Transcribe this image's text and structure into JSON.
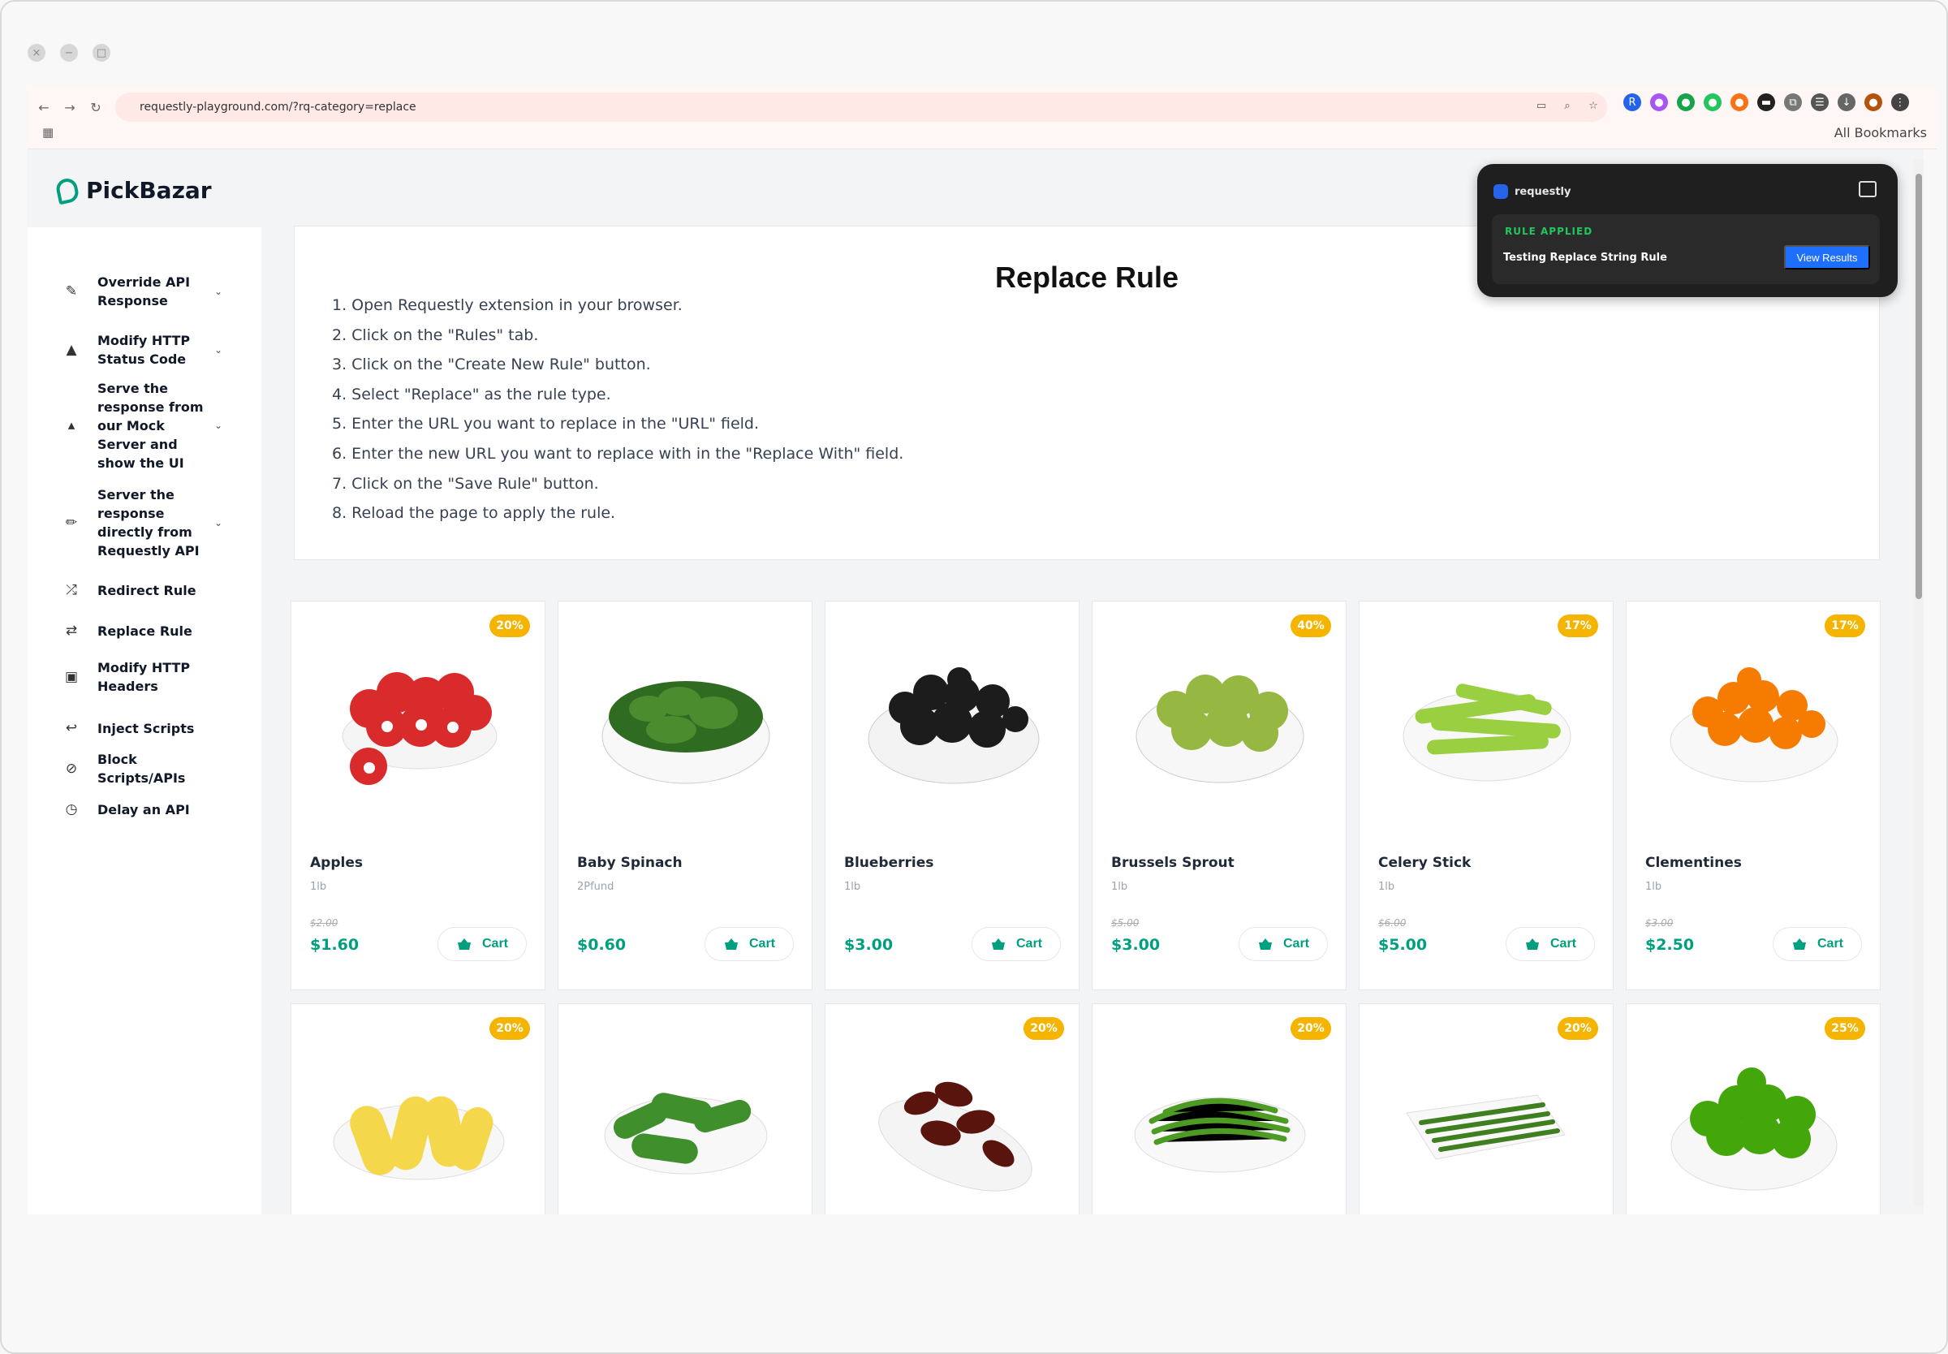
{
  "window": {
    "buttons": [
      "×",
      "−",
      "□"
    ]
  },
  "browser": {
    "url": "requestly-playground.com/?rq-category=replace",
    "bookmarks_label": "All Bookmarks"
  },
  "brand": {
    "name": "PickBazar",
    "accent": "#009f7f"
  },
  "sidebar": {
    "items": [
      {
        "label": "Override API Response",
        "icon": "pencil-icon",
        "chevron": true
      },
      {
        "label": "Modify HTTP Status Code",
        "icon": "triangle-icon",
        "chevron": true
      },
      {
        "label": "Serve the response from our Mock Server and show the UI",
        "icon": "caret-icon",
        "chevron": true
      },
      {
        "label": "Server the response directly from Requestly API",
        "icon": "pen-icon",
        "chevron": true
      },
      {
        "label": "Redirect Rule",
        "icon": "shuffle-icon",
        "chevron": false
      },
      {
        "label": "Replace Rule",
        "icon": "swap-icon",
        "chevron": false
      },
      {
        "label": "Modify HTTP Headers",
        "icon": "browser-icon",
        "chevron": false
      },
      {
        "label": "Inject Scripts",
        "icon": "return-icon",
        "chevron": false
      },
      {
        "label": "Block Scripts/APIs",
        "icon": "block-icon",
        "chevron": false
      },
      {
        "label": "Delay an API",
        "icon": "clock-icon",
        "chevron": false
      }
    ]
  },
  "guide": {
    "title": "Replace Rule",
    "steps": [
      "1. Open Requestly extension in your browser.",
      "2. Click on the \"Rules\" tab.",
      "3. Click on the \"Create New Rule\" button.",
      "4. Select \"Replace\" as the rule type.",
      "5. Enter the URL you want to replace in the \"URL\" field.",
      "6. Enter the new URL you want to replace with in the \"Replace With\" field.",
      "7. Click on the \"Save Rule\" button.",
      "8. Reload the page to apply the rule."
    ]
  },
  "products": [
    {
      "name": "Apples",
      "unit": "1lb",
      "old_price": "$2.00",
      "price": "$1.60",
      "badge": "20%",
      "image": "apples"
    },
    {
      "name": "Baby Spinach",
      "unit": "2Pfund",
      "old_price": "",
      "price": "$0.60",
      "badge": "",
      "image": "spinach"
    },
    {
      "name": "Blueberries",
      "unit": "1lb",
      "old_price": "",
      "price": "$3.00",
      "badge": "",
      "image": "blueberries"
    },
    {
      "name": "Brussels Sprout",
      "unit": "1lb",
      "old_price": "$5.00",
      "price": "$3.00",
      "badge": "40%",
      "image": "brussels"
    },
    {
      "name": "Celery Stick",
      "unit": "1lb",
      "old_price": "$6.00",
      "price": "$5.00",
      "badge": "17%",
      "image": "celery"
    },
    {
      "name": "Clementines",
      "unit": "1lb",
      "old_price": "$3.00",
      "price": "$2.50",
      "badge": "17%",
      "image": "clementines"
    },
    {
      "name": "",
      "unit": "",
      "old_price": "",
      "price": "",
      "badge": "20%",
      "image": "corn"
    },
    {
      "name": "",
      "unit": "",
      "old_price": "",
      "price": "",
      "badge": "",
      "image": "cucumbers"
    },
    {
      "name": "",
      "unit": "",
      "old_price": "",
      "price": "",
      "badge": "20%",
      "image": "dates"
    },
    {
      "name": "",
      "unit": "",
      "old_price": "",
      "price": "",
      "badge": "20%",
      "image": "green-beans"
    },
    {
      "name": "",
      "unit": "",
      "old_price": "",
      "price": "",
      "badge": "20%",
      "image": "long-beans"
    },
    {
      "name": "",
      "unit": "",
      "old_price": "",
      "price": "",
      "badge": "25%",
      "image": "limes"
    }
  ],
  "cart_label": "Cart",
  "popup": {
    "brand": "requestly",
    "status": "RULE APPLIED",
    "rule": "Testing Replace String Rule",
    "button": "View Results"
  }
}
